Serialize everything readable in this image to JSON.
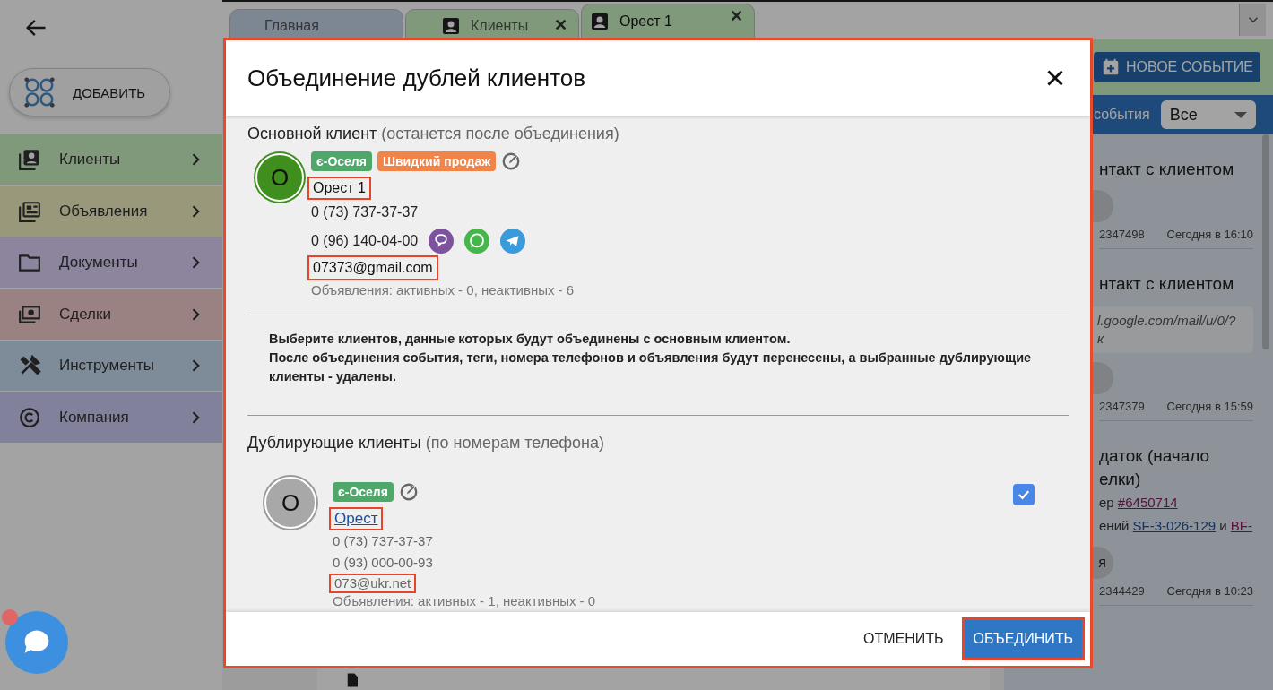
{
  "sidebar": {
    "add_button": "ДОБАВИТЬ",
    "items": [
      {
        "label": "Клиенты"
      },
      {
        "label": "Объявления"
      },
      {
        "label": "Документы"
      },
      {
        "label": "Сделки"
      },
      {
        "label": "Инструменты"
      },
      {
        "label": "Компания"
      }
    ]
  },
  "tabs": [
    {
      "label": "Главная",
      "selected": false,
      "icon": false
    },
    {
      "label": "Клиенты",
      "selected": false,
      "icon": true,
      "close": "✕"
    },
    {
      "label": "Орест 1",
      "selected": true,
      "icon": true,
      "close": "✕"
    }
  ],
  "events_panel": {
    "new_event_button": "НОВОЕ СОБЫТИЕ",
    "filter_label": "события",
    "filter_value": "Все",
    "events": [
      {
        "title_lines": [
          "нтакт с клиентом"
        ],
        "id": "2347498",
        "time": "Сегодня в 16:10"
      },
      {
        "title_lines": [
          "нтакт с клиентом"
        ],
        "quote_lines": [
          "l.google.com/mail/u/0/?",
          "к"
        ],
        "id": "2347379",
        "time": "Сегодня в 15:59"
      },
      {
        "title_lines": [
          "даток (начало",
          "елки)"
        ],
        "details": [
          [
            {
              "text": "ер "
            },
            {
              "text": "#6450714",
              "link": true,
              "visited": true
            }
          ],
          [
            {
              "text": "ений "
            },
            {
              "text": "SF-3-026-129",
              "link": true,
              "visited": false
            },
            {
              "text": " и "
            },
            {
              "text": "BF-",
              "link": true,
              "visited": true
            }
          ]
        ],
        "avatar_letter": "я",
        "id": "2344429",
        "time": "Сегодня в 10:23"
      }
    ]
  },
  "dialog": {
    "title": "Объединение дублей клиентов",
    "highlighted": true,
    "main_client": {
      "heading": "Основной клиент",
      "hint": "(останется после объединения)",
      "avatar_letter": "О",
      "tags": [
        {
          "label": "є-Оселя",
          "color": "#4fa76a"
        },
        {
          "label": "Швидкий продаж",
          "color": "#f08449"
        }
      ],
      "name": "Орест 1",
      "name_link": false,
      "name_highlighted": true,
      "phones": [
        {
          "number": "0 (73) 737-37-37"
        },
        {
          "number": "0 (96) 140-04-00",
          "messengers": [
            {
              "kind": "viber"
            },
            {
              "kind": "whatsapp"
            },
            {
              "kind": "telegram"
            }
          ]
        }
      ],
      "email": "07373@gmail.com",
      "email_highlighted": true,
      "listings": "Объявления: активных - 0, неактивных - 6"
    },
    "notice_lines": [
      "Выберите клиентов, данные которых будут объединены с основным клиентом.",
      "После объединения события, теги, номера телефонов и объявления будут перенесены, а выбранные дублирующие клиенты - удалены."
    ],
    "duplicates": {
      "heading": "Дублирующие клиенты",
      "hint": "(по номерам телефона)",
      "clients": [
        {
          "avatar_letter": "О",
          "tags": [
            {
              "label": "є-Оселя",
              "color": "#4fa76a"
            }
          ],
          "name": "Орест",
          "name_link": true,
          "name_highlighted": true,
          "phones": [
            {
              "number": "0 (73) 737-37-37"
            },
            {
              "number": "0 (93) 000-00-93"
            }
          ],
          "email": "073@ukr.net",
          "email_highlighted": true,
          "listings": "Объявления: активных - 1, неактивных - 0",
          "checked": true
        }
      ]
    },
    "cancel_button": "ОТМЕНИТЬ",
    "merge_button": "ОБЪЕДИНИТЬ",
    "merge_highlighted": true
  }
}
